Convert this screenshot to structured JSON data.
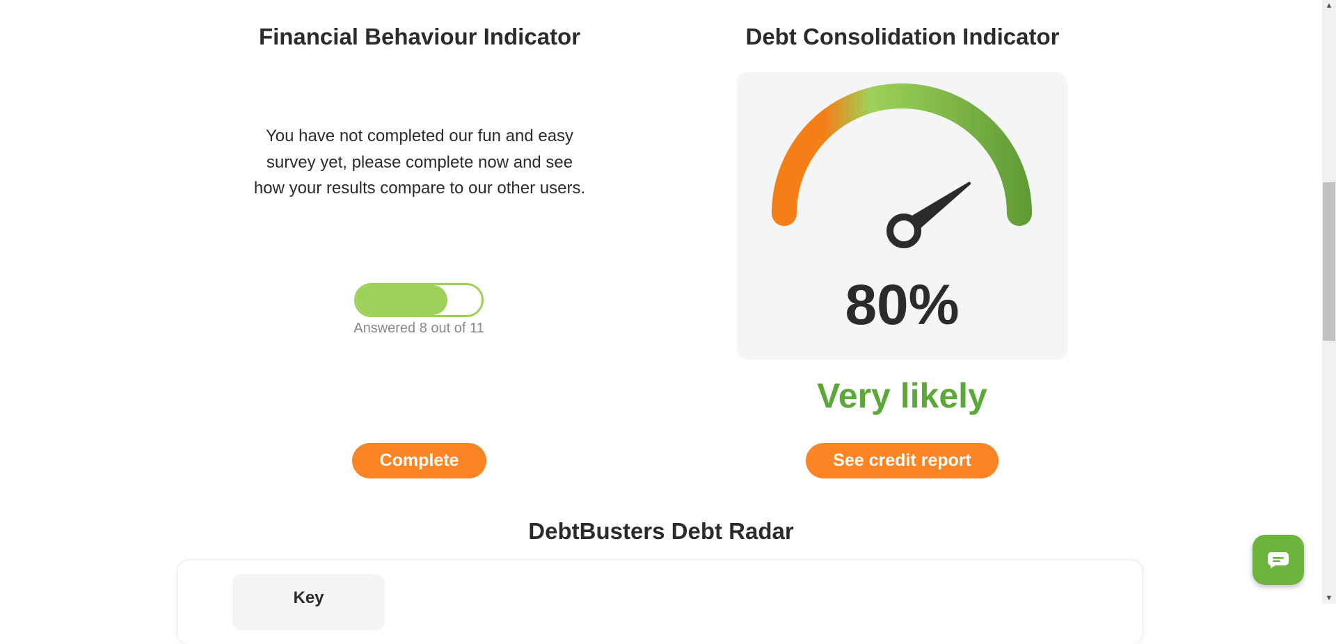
{
  "financial_behaviour": {
    "title": "Financial Behaviour Indicator",
    "message": "You have not completed our fun and easy survey yet, please complete now and see how your results compare to our other users.",
    "answered": 8,
    "total": 11,
    "progress_text": "Answered 8 out of 11",
    "button_label": "Complete"
  },
  "debt_consolidation": {
    "title": "Debt Consolidation Indicator",
    "gauge_value_percent": 80,
    "gauge_label": "80%",
    "likelihood": "Very likely",
    "button_label": "See credit report"
  },
  "debt_radar": {
    "title": "DebtBusters Debt Radar",
    "key_label": "Key"
  },
  "chat": {
    "icon": "chat-bubble-icon"
  },
  "colors": {
    "accent_orange": "#fb8424",
    "accent_green": "#6cb43b",
    "likelihood_green": "#5ba838",
    "progress_green": "#9dd15a",
    "gauge_start": "#f57f17",
    "gauge_mid": "#9dd15a",
    "gauge_end": "#5e9a34"
  }
}
